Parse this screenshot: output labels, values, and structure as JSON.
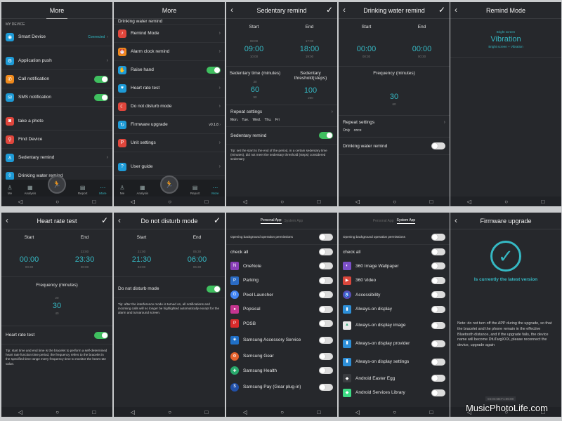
{
  "more1": {
    "title": "More",
    "section": "MY DEVICE",
    "smart_device": "Smart Device",
    "connected": "Connected",
    "items": [
      "Application push",
      "Call notification",
      "SMS notification",
      "take a photo",
      "Find Device",
      "Sedentary remind",
      "Drinking water remind"
    ],
    "tabs": [
      "Me",
      "Analysis",
      "",
      "Report",
      "More"
    ]
  },
  "more2": {
    "title": "More",
    "top_cut": "Drinking water remind",
    "items": [
      "Remind Mode",
      "Alarm clock remind",
      "Raise hand",
      "Heart rate test",
      "Do not disturb mode",
      "Firmware upgrade",
      "Unit settings",
      "User guide"
    ],
    "fw_version": "v0.1.8",
    "tabs": [
      "Me",
      "Analysis",
      "",
      "Report",
      "More"
    ]
  },
  "sedentary": {
    "title": "Sedentary remind",
    "start": "Start",
    "end": "End",
    "start_above": "08:00",
    "start_val": "09:00",
    "start_below": "10:00",
    "end_above": "17:00",
    "end_val": "18:00",
    "end_below": "19:00",
    "time_label": "Sedentary time (minutes)",
    "threshold_label": "Sedentary threshold(steps)",
    "time_above": "30",
    "time_val": "60",
    "time_below": "90",
    "steps_above": "",
    "steps_val": "100",
    "steps_below": "200",
    "repeat": "Repeat settings",
    "days": "Mon. Tue. Wed. Thu. Fri",
    "toggle_label": "Sedentary remind",
    "tip": "Tip: set the start to the end of the period, in a certain sedentary time (minutes), did not meet the sedentary threshold (steps) considered sedentary"
  },
  "water": {
    "title": "Drinking water remind",
    "start": "Start",
    "end": "End",
    "start_above": "",
    "start_val": "00:00",
    "start_below": "00:30",
    "end_above": "",
    "end_val": "00:00",
    "end_below": "00:30",
    "freq_label": "Frequency (minutes)",
    "freq_above": "",
    "freq_val": "30",
    "freq_below": "60",
    "repeat": "Repeat settings",
    "repeat_val": "Only once",
    "toggle_label": "Drinking water remind"
  },
  "remind_mode": {
    "title": "Remind Mode",
    "above": "Bright screen",
    "value": "Vibration",
    "below": "Bright screen + Vibration"
  },
  "heart": {
    "title": "Heart rate test",
    "start": "Start",
    "end": "End",
    "start_above": "",
    "start_val": "00:00",
    "start_below": "00:30",
    "end_above": "23:00",
    "end_val": "23:30",
    "end_below": "00:00",
    "freq_label": "Frequency (minutes)",
    "freq_above": "20",
    "freq_val": "30",
    "freq_below": "40",
    "toggle_label": "Heart rate test",
    "tip": "Tip: start time and end time is the bracelet to perform a self-determined heart rate function time period, the frequency refers to the bracelet in the specified time range every frequency time to monitor the heart rate value."
  },
  "dnd": {
    "title": "Do not disturb mode",
    "start": "Start",
    "end": "End",
    "start_above": "21:00",
    "start_val": "21:30",
    "start_below": "22:00",
    "end_above": "05:30",
    "end_val": "06:00",
    "end_below": "06:30",
    "toggle_label": "Do not disturb mode",
    "tip": "Tip: after the interference mode is turned on, all notifications and incoming calls will no longer be highlighted automatically except for the alarm and turnaround screen."
  },
  "personal_apps": {
    "tab_personal": "Personal App",
    "tab_system": "System App",
    "perm": "Opening background operation permissions",
    "check_all": "check all",
    "apps": [
      "OneNote",
      "Parking",
      "Pixel Launcher",
      "Popsical",
      "POSB",
      "Samsung Accessory Service",
      "Samsung Gear",
      "Samsung Health",
      "Samsung Pay (Gear plug-in)"
    ]
  },
  "system_apps": {
    "tab_personal": "Personal App",
    "tab_system": "System App",
    "perm": "Opening background operation permissions",
    "check_all": "check all",
    "apps": [
      "360 Image Wallpaper",
      "360 Video",
      "Accessibility",
      "Always-on display",
      "Always-on display image",
      "Always-on display provider",
      "Always-on display settings",
      "Android Easter Egg",
      "Android Services Library"
    ]
  },
  "firmware": {
    "title": "Firmware upgrade",
    "latest": "Is currently the latest version",
    "note": "Note: do not turn off the APP during the upgrade, so that the bracelet and the phone remain in the effective Bluetooth distance, and if the upgrade fails, the device name will become DfuTargXXX, please reconnect the device, upgrade again",
    "version": "04:04:5B:F1:06:08"
  },
  "watermark": "MusicPhotoLife.com",
  "colors": {
    "accent": "#35b8c3",
    "toggle_on": "#3fbf5f",
    "panel_bg": "#26282c"
  }
}
